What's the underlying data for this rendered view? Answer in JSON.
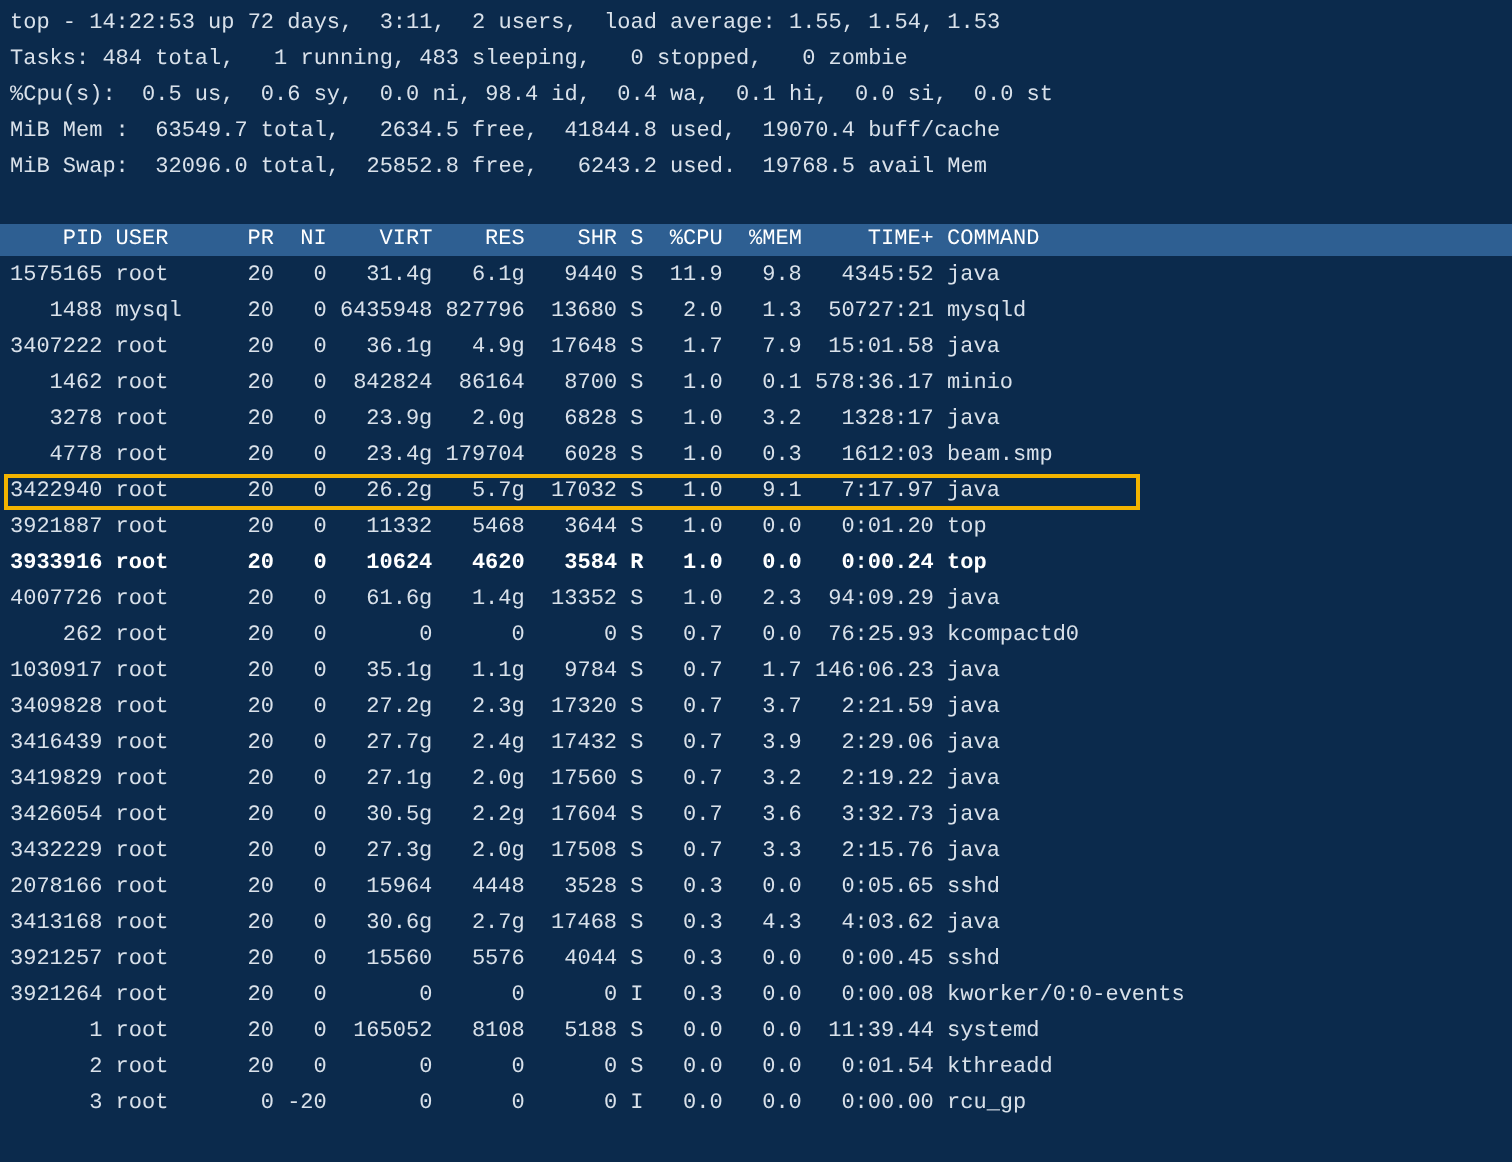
{
  "summary": [
    "top - 14:22:53 up 72 days,  3:11,  2 users,  load average: 1.55, 1.54, 1.53",
    "Tasks: 484 total,   1 running, 483 sleeping,   0 stopped,   0 zombie",
    "%Cpu(s):  0.5 us,  0.6 sy,  0.0 ni, 98.4 id,  0.4 wa,  0.1 hi,  0.0 si,  0.0 st",
    "MiB Mem :  63549.7 total,   2634.5 free,  41844.8 used,  19070.4 buff/cache",
    "MiB Swap:  32096.0 total,  25852.8 free,   6243.2 used.  19768.5 avail Mem"
  ],
  "table": {
    "columns": [
      "PID",
      "USER",
      "PR",
      "NI",
      "VIRT",
      "RES",
      "SHR",
      "S",
      "%CPU",
      "%MEM",
      "TIME+",
      "COMMAND"
    ],
    "rows": [
      {
        "cells": [
          "1575165",
          "root",
          "20",
          "0",
          "31.4g",
          "6.1g",
          "9440",
          "S",
          "11.9",
          "9.8",
          "4345:52",
          "java"
        ],
        "selected": false,
        "bold": false
      },
      {
        "cells": [
          "1488",
          "mysql",
          "20",
          "0",
          "6435948",
          "827796",
          "13680",
          "S",
          "2.0",
          "1.3",
          "50727:21",
          "mysqld"
        ],
        "selected": false,
        "bold": false
      },
      {
        "cells": [
          "3407222",
          "root",
          "20",
          "0",
          "36.1g",
          "4.9g",
          "17648",
          "S",
          "1.7",
          "7.9",
          "15:01.58",
          "java"
        ],
        "selected": false,
        "bold": false
      },
      {
        "cells": [
          "1462",
          "root",
          "20",
          "0",
          "842824",
          "86164",
          "8700",
          "S",
          "1.0",
          "0.1",
          "578:36.17",
          "minio"
        ],
        "selected": false,
        "bold": false
      },
      {
        "cells": [
          "3278",
          "root",
          "20",
          "0",
          "23.9g",
          "2.0g",
          "6828",
          "S",
          "1.0",
          "3.2",
          "1328:17",
          "java"
        ],
        "selected": false,
        "bold": false
      },
      {
        "cells": [
          "4778",
          "root",
          "20",
          "0",
          "23.4g",
          "179704",
          "6028",
          "S",
          "1.0",
          "0.3",
          "1612:03",
          "beam.smp"
        ],
        "selected": false,
        "bold": false
      },
      {
        "cells": [
          "3422940",
          "root",
          "20",
          "0",
          "26.2g",
          "5.7g",
          "17032",
          "S",
          "1.0",
          "9.1",
          "7:17.97",
          "java"
        ],
        "selected": true,
        "bold": false
      },
      {
        "cells": [
          "3921887",
          "root",
          "20",
          "0",
          "11332",
          "5468",
          "3644",
          "S",
          "1.0",
          "0.0",
          "0:01.20",
          "top"
        ],
        "selected": false,
        "bold": false
      },
      {
        "cells": [
          "3933916",
          "root",
          "20",
          "0",
          "10624",
          "4620",
          "3584",
          "R",
          "1.0",
          "0.0",
          "0:00.24",
          "top"
        ],
        "selected": false,
        "bold": true
      },
      {
        "cells": [
          "4007726",
          "root",
          "20",
          "0",
          "61.6g",
          "1.4g",
          "13352",
          "S",
          "1.0",
          "2.3",
          "94:09.29",
          "java"
        ],
        "selected": false,
        "bold": false
      },
      {
        "cells": [
          "262",
          "root",
          "20",
          "0",
          "0",
          "0",
          "0",
          "S",
          "0.7",
          "0.0",
          "76:25.93",
          "kcompactd0"
        ],
        "selected": false,
        "bold": false
      },
      {
        "cells": [
          "1030917",
          "root",
          "20",
          "0",
          "35.1g",
          "1.1g",
          "9784",
          "S",
          "0.7",
          "1.7",
          "146:06.23",
          "java"
        ],
        "selected": false,
        "bold": false
      },
      {
        "cells": [
          "3409828",
          "root",
          "20",
          "0",
          "27.2g",
          "2.3g",
          "17320",
          "S",
          "0.7",
          "3.7",
          "2:21.59",
          "java"
        ],
        "selected": false,
        "bold": false
      },
      {
        "cells": [
          "3416439",
          "root",
          "20",
          "0",
          "27.7g",
          "2.4g",
          "17432",
          "S",
          "0.7",
          "3.9",
          "2:29.06",
          "java"
        ],
        "selected": false,
        "bold": false
      },
      {
        "cells": [
          "3419829",
          "root",
          "20",
          "0",
          "27.1g",
          "2.0g",
          "17560",
          "S",
          "0.7",
          "3.2",
          "2:19.22",
          "java"
        ],
        "selected": false,
        "bold": false
      },
      {
        "cells": [
          "3426054",
          "root",
          "20",
          "0",
          "30.5g",
          "2.2g",
          "17604",
          "S",
          "0.7",
          "3.6",
          "3:32.73",
          "java"
        ],
        "selected": false,
        "bold": false
      },
      {
        "cells": [
          "3432229",
          "root",
          "20",
          "0",
          "27.3g",
          "2.0g",
          "17508",
          "S",
          "0.7",
          "3.3",
          "2:15.76",
          "java"
        ],
        "selected": false,
        "bold": false
      },
      {
        "cells": [
          "2078166",
          "root",
          "20",
          "0",
          "15964",
          "4448",
          "3528",
          "S",
          "0.3",
          "0.0",
          "0:05.65",
          "sshd"
        ],
        "selected": false,
        "bold": false
      },
      {
        "cells": [
          "3413168",
          "root",
          "20",
          "0",
          "30.6g",
          "2.7g",
          "17468",
          "S",
          "0.3",
          "4.3",
          "4:03.62",
          "java"
        ],
        "selected": false,
        "bold": false
      },
      {
        "cells": [
          "3921257",
          "root",
          "20",
          "0",
          "15560",
          "5576",
          "4044",
          "S",
          "0.3",
          "0.0",
          "0:00.45",
          "sshd"
        ],
        "selected": false,
        "bold": false
      },
      {
        "cells": [
          "3921264",
          "root",
          "20",
          "0",
          "0",
          "0",
          "0",
          "I",
          "0.3",
          "0.0",
          "0:00.08",
          "kworker/0:0-events"
        ],
        "selected": false,
        "bold": false
      },
      {
        "cells": [
          "1",
          "root",
          "20",
          "0",
          "165052",
          "8108",
          "5188",
          "S",
          "0.0",
          "0.0",
          "11:39.44",
          "systemd"
        ],
        "selected": false,
        "bold": false
      },
      {
        "cells": [
          "2",
          "root",
          "20",
          "0",
          "0",
          "0",
          "0",
          "S",
          "0.0",
          "0.0",
          "0:01.54",
          "kthreadd"
        ],
        "selected": false,
        "bold": false
      },
      {
        "cells": [
          "3",
          "root",
          "0",
          "-20",
          "0",
          "0",
          "0",
          "I",
          "0.0",
          "0.0",
          "0:00.00",
          "rcu_gp"
        ],
        "selected": false,
        "bold": false
      }
    ]
  }
}
